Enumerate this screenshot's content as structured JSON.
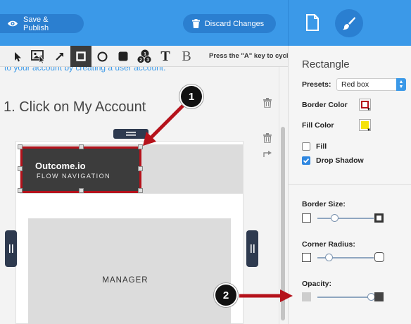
{
  "topbar": {
    "save_label": "Save & Publish",
    "discard_label": "Discard Changes"
  },
  "right_tabs": [
    "document-icon",
    "brush-icon"
  ],
  "toolbar": {
    "tools": [
      "pointer-icon",
      "image-cursor-icon",
      "arrow-icon",
      "rectangle-icon",
      "circle-icon",
      "rounded-rect-icon",
      "numbered-steps-icon",
      "text-icon",
      "bold-text-icon"
    ],
    "active_tool": "rectangle-icon",
    "text_tool_glyph": "T",
    "bold_tool_glyph": "B",
    "hint": "Press the \"A\" key to cycle"
  },
  "content": {
    "link_text": "to your account by creating a user account.",
    "step_title": "1. Click on My Account"
  },
  "screenshot": {
    "logo_name": "Outcome.io",
    "logo_sub": "FLOW NAVIGATION",
    "manager_label": "MANAGER"
  },
  "props": {
    "title": "Rectangle",
    "presets_label": "Presets:",
    "preset_value": "Red box",
    "border_color_label": "Border Color",
    "border_color": "#b5121b",
    "fill_color_label": "Fill Color",
    "fill_color": "#f5e20a",
    "fill_label": "Fill",
    "fill_checked": false,
    "drop_shadow_label": "Drop Shadow",
    "drop_shadow_checked": true,
    "border_size_label": "Border Size:",
    "border_size_level": 0.3,
    "corner_radius_label": "Corner Radius:",
    "corner_radius_level": 0.2,
    "opacity_label": "Opacity:",
    "opacity_level": 1.0
  },
  "callouts": [
    "1",
    "2"
  ],
  "colors": {
    "accent": "#3b99e8",
    "callout_arrow": "#b5121b"
  }
}
